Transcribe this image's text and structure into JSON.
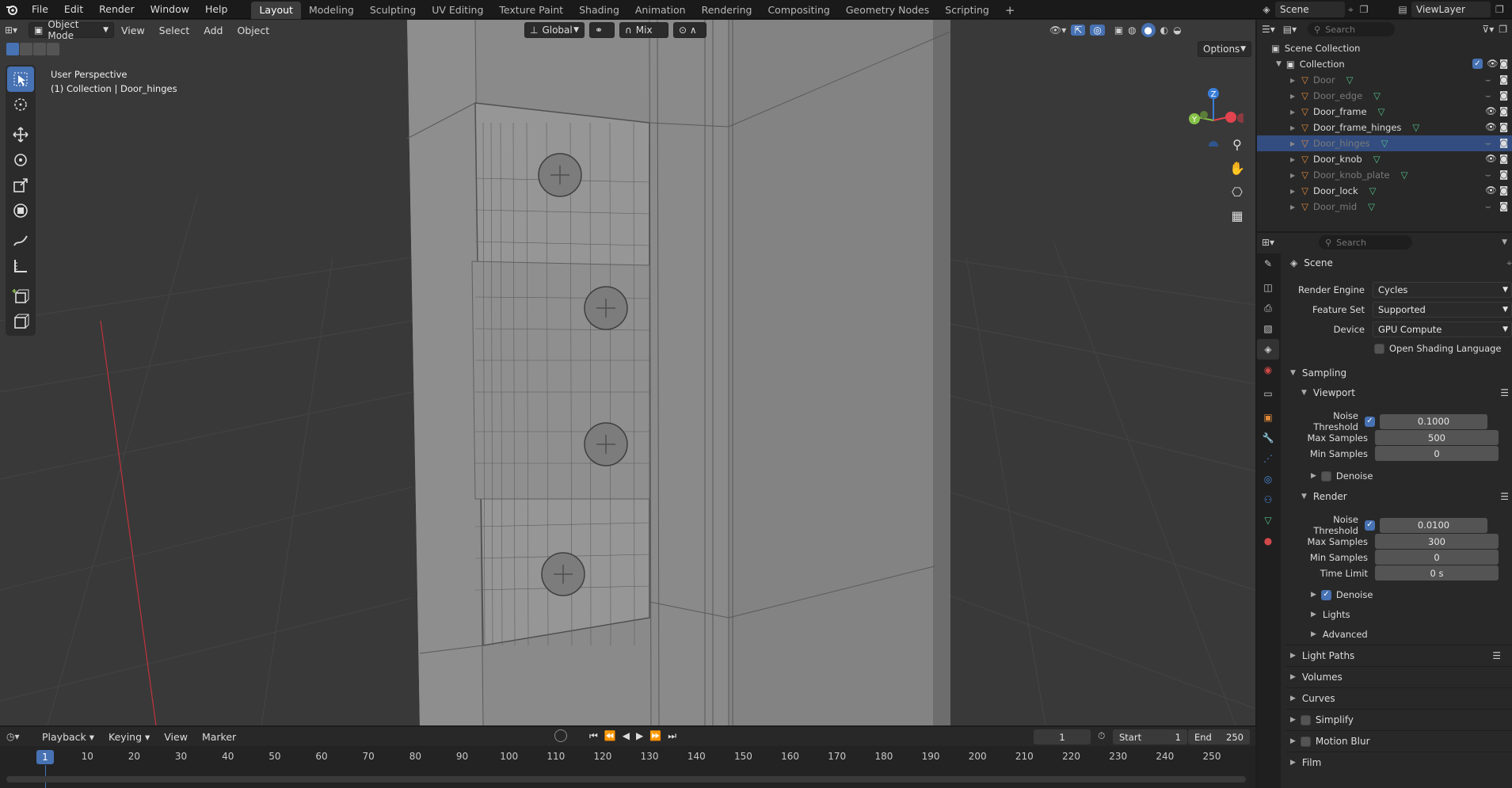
{
  "topbar": {
    "menus": [
      "File",
      "Edit",
      "Render",
      "Window",
      "Help"
    ],
    "workspaces": [
      "Layout",
      "Modeling",
      "Sculpting",
      "UV Editing",
      "Texture Paint",
      "Shading",
      "Animation",
      "Rendering",
      "Compositing",
      "Geometry Nodes",
      "Scripting"
    ],
    "active_workspace": "Layout",
    "scene": "Scene",
    "view_layer": "ViewLayer"
  },
  "viewport": {
    "mode": "Object Mode",
    "menus": [
      "View",
      "Select",
      "Add",
      "Object"
    ],
    "transform_orientation": "Global",
    "snap_label": "Mix",
    "options_label": "Options",
    "perspective_label": "User Perspective",
    "context_label": "(1) Collection | Door_hinges",
    "gizmo_axes": [
      "Z",
      "Y"
    ],
    "colors": {
      "x_axis": "#e2434e",
      "y_axis": "#86c247",
      "z_axis": "#3a7ed8",
      "selection": "#4772b3"
    }
  },
  "outliner": {
    "search_placeholder": "Search",
    "root": "Scene Collection",
    "collection": "Collection",
    "items": [
      {
        "name": "Door",
        "visible": false
      },
      {
        "name": "Door_edge",
        "visible": false
      },
      {
        "name": "Door_frame",
        "visible": true
      },
      {
        "name": "Door_frame_hinges",
        "visible": true
      },
      {
        "name": "Door_hinges",
        "visible": false,
        "selected": true
      },
      {
        "name": "Door_knob",
        "visible": true
      },
      {
        "name": "Door_knob_plate",
        "visible": false
      },
      {
        "name": "Door_lock",
        "visible": true
      },
      {
        "name": "Door_mid",
        "visible": false
      }
    ]
  },
  "properties": {
    "search_placeholder": "Search",
    "context_title": "Scene",
    "render_engine_label": "Render Engine",
    "render_engine": "Cycles",
    "feature_set_label": "Feature Set",
    "feature_set": "Supported",
    "device_label": "Device",
    "device": "GPU Compute",
    "osl_label": "Open Shading Language",
    "sampling": "Sampling",
    "viewport": {
      "title": "Viewport",
      "noise_threshold_label": "Noise Threshold",
      "noise_threshold": "0.1000",
      "max_samples_label": "Max Samples",
      "max_samples": "500",
      "min_samples_label": "Min Samples",
      "min_samples": "0",
      "denoise_label": "Denoise"
    },
    "render": {
      "title": "Render",
      "noise_threshold_label": "Noise Threshold",
      "noise_threshold": "0.0100",
      "max_samples_label": "Max Samples",
      "max_samples": "300",
      "min_samples_label": "Min Samples",
      "min_samples": "0",
      "time_limit_label": "Time Limit",
      "time_limit": "0 s",
      "denoise_label": "Denoise"
    },
    "lights": "Lights",
    "advanced": "Advanced",
    "light_paths": "Light Paths",
    "volumes": "Volumes",
    "curves": "Curves",
    "simplify": "Simplify",
    "motion_blur": "Motion Blur",
    "film": "Film"
  },
  "timeline": {
    "menus": [
      "Playback",
      "Keying",
      "View",
      "Marker"
    ],
    "current_frame": "1",
    "start_label": "Start",
    "start": "1",
    "end_label": "End",
    "end": "250",
    "ticks": [
      "10",
      "20",
      "30",
      "40",
      "50",
      "60",
      "70",
      "80",
      "90",
      "100",
      "110",
      "120",
      "130",
      "140",
      "150",
      "160",
      "170",
      "180",
      "190",
      "200",
      "210",
      "220",
      "230",
      "240",
      "250"
    ]
  }
}
